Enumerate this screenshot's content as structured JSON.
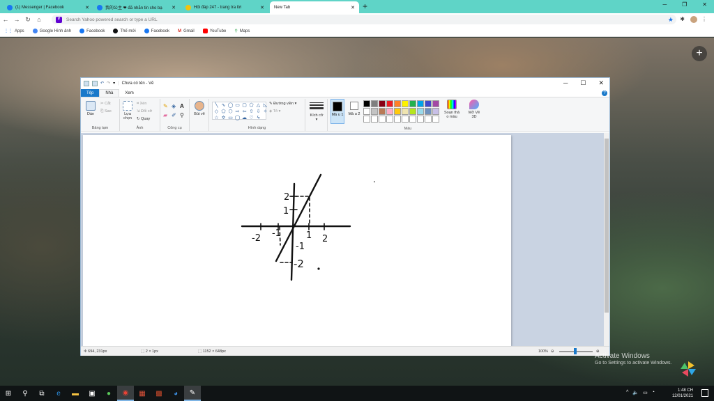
{
  "browser": {
    "tabs": [
      {
        "title": "(1) Messenger | Facebook",
        "favicon_color": "#1877f2"
      },
      {
        "title": "我的公主 ❤ đã nhắn tin cho bạ",
        "favicon_color": "#1877f2"
      },
      {
        "title": "Hỏi đáp 247 - trang tra lời",
        "favicon_color": "#f4c20d"
      },
      {
        "title": "New Tab",
        "favicon_color": ""
      }
    ],
    "address_placeholder": "Search Yahoo powered search or type a URL",
    "bookmarks": [
      "Apps",
      "Google Hình ảnh",
      "Facebook",
      "Thế mới",
      "Facebook",
      "Gmail",
      "YouTube",
      "Maps"
    ]
  },
  "paint": {
    "title": "Chưa có tên - Vẽ",
    "tabs": [
      "Tệp",
      "Nhà",
      "Xem"
    ],
    "groups": {
      "clipboard": {
        "paste": "Dán",
        "cut": "Cắt",
        "copy": "Sao",
        "label": "Bảng tạm"
      },
      "image": {
        "select": "Lựa chọn",
        "crop": "Xén",
        "resize": "Đổi cỡ",
        "rotate": "Quay",
        "label": "Ảnh"
      },
      "tools": {
        "label": "Công cụ"
      },
      "brushes": {
        "label": "Bút vẽ"
      },
      "shapes": {
        "outline": "Đường viền",
        "fill": "Tô",
        "label": "Hình dạng"
      },
      "size": {
        "label": "Kích cỡ"
      },
      "colors": {
        "color1": "Mà u 1",
        "color2": "Mà u 2",
        "edit": "Soạn thả o màu",
        "paint3d": "Mở Vẽ 3D",
        "label": "Màu"
      }
    },
    "palette": [
      "#000000",
      "#7f7f7f",
      "#880015",
      "#ed1c24",
      "#ff7f27",
      "#fff200",
      "#22b14c",
      "#00a2e8",
      "#3f48cc",
      "#a349a4",
      "#ffffff",
      "#c3c3c3",
      "#b97a57",
      "#ffaec9",
      "#ffc90e",
      "#efe4b0",
      "#b5e61d",
      "#99d9ea",
      "#7092be",
      "#c8bfe7",
      "#ffffff",
      "#ffffff",
      "#ffffff",
      "#ffffff",
      "#ffffff",
      "#ffffff",
      "#ffffff",
      "#ffffff",
      "#ffffff",
      "#ffffff"
    ],
    "drawing_labels": {
      "y2": "2",
      "y1": "1",
      "xm2": "-2",
      "xm1": "-1",
      "x1": "1",
      "x2": "2",
      "ym1": "-1",
      "ym2": "-2"
    },
    "status": {
      "cursor": "694, 231px",
      "selection": "2 × 1px",
      "canvas_size": "1152 × 648px",
      "zoom": "100%"
    }
  },
  "desktop": {
    "activate_title": "Activate Windows",
    "activate_sub": "Go to Settings to activate Windows."
  },
  "taskbar": {
    "time": "1:48 CH",
    "date": "12/01/2021"
  }
}
